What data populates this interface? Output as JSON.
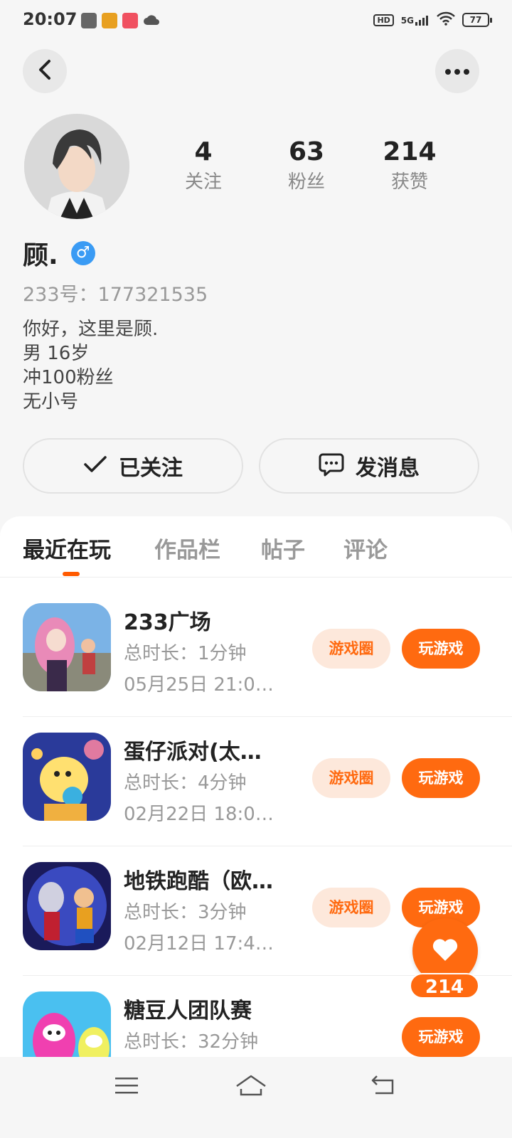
{
  "status_bar": {
    "time": "20:07",
    "hd": "HD",
    "network": "5G",
    "battery": "77"
  },
  "profile": {
    "following_count": "4",
    "following_label": "关注",
    "followers_count": "63",
    "followers_label": "粉丝",
    "likes_count": "214",
    "likes_label": "获赞",
    "name": "顾.",
    "gender_symbol": "♂",
    "user_id": "233号：177321535",
    "bio": [
      "你好，这里是顾.",
      "男 16岁",
      "冲100粉丝",
      "无小号"
    ]
  },
  "actions": {
    "follow_label": "已关注",
    "message_label": "发消息"
  },
  "tabs": [
    {
      "label": "最近在玩",
      "active": true
    },
    {
      "label": "作品栏",
      "active": false
    },
    {
      "label": "帖子",
      "active": false
    },
    {
      "label": "评论",
      "active": false
    }
  ],
  "games": [
    {
      "name": "233广场",
      "duration": "总时长：1分钟",
      "last_played": "05月25日 21:0…",
      "circle_label": "游戏圈",
      "play_label": "玩游戏"
    },
    {
      "name": "蛋仔派对(太…",
      "duration": "总时长：4分钟",
      "last_played": "02月22日 18:0…",
      "circle_label": "游戏圈",
      "play_label": "玩游戏"
    },
    {
      "name": "地铁跑酷（欧…",
      "duration": "总时长：3分钟",
      "last_played": "02月12日 17:4…",
      "circle_label": "游戏圈",
      "play_label": "玩游戏"
    },
    {
      "name": "糖豆人团队赛",
      "duration": "总时长：32分钟",
      "last_played": "",
      "circle_label": "",
      "play_label": "玩游戏"
    }
  ],
  "like_fab": {
    "count": "214"
  },
  "colors": {
    "accent": "#ff6a10",
    "accent_light": "#fde8db",
    "gender_blue": "#3a9bf4",
    "background": "#f6f6f6"
  },
  "icons": [
    "back-icon",
    "more-icon",
    "check-icon",
    "chat-icon",
    "heart-icon",
    "menu-icon",
    "home-icon",
    "return-icon"
  ]
}
